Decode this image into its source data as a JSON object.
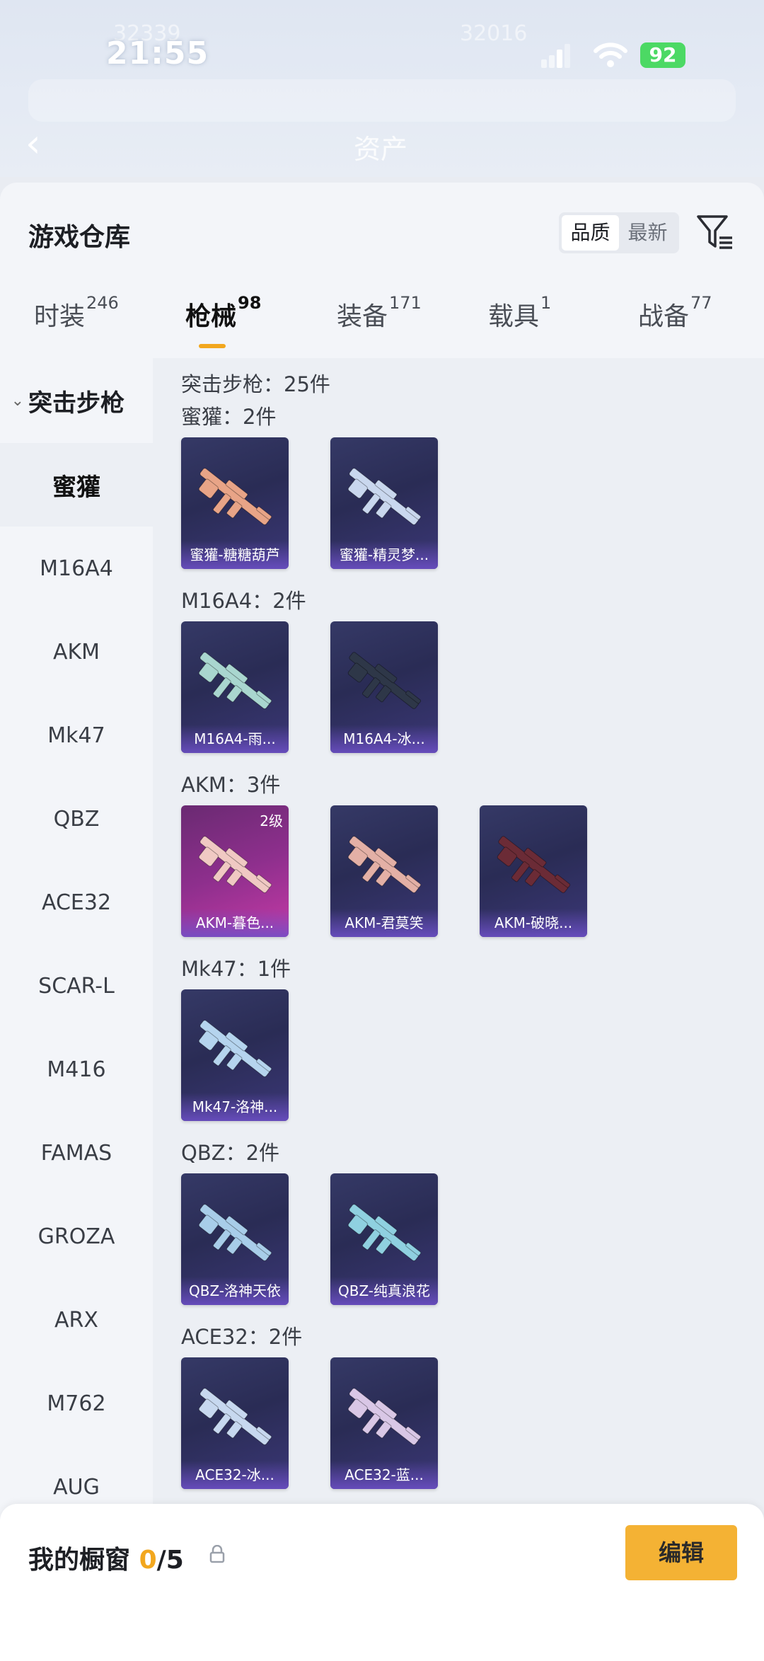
{
  "status_bar": {
    "time": "21:55",
    "battery": "92",
    "blurred_left": "32339",
    "blurred_right": "32016"
  },
  "nav": {
    "title": "资产"
  },
  "sheet": {
    "title": "游戏仓库",
    "sort": {
      "quality": "品质",
      "newest": "最新",
      "active": "quality"
    },
    "tabs": [
      {
        "label": "时装",
        "count": "246"
      },
      {
        "label": "枪械",
        "count": "98"
      },
      {
        "label": "装备",
        "count": "171"
      },
      {
        "label": "载具",
        "count": "1"
      },
      {
        "label": "战备",
        "count": "77"
      }
    ],
    "active_tab": "枪械",
    "accent_color": "#f2a71e"
  },
  "sidebar": {
    "category": "突击步枪",
    "items": [
      "蜜獾",
      "M16A4",
      "AKM",
      "Mk47",
      "QBZ",
      "ACE32",
      "SCAR-L",
      "M416",
      "FAMAS",
      "GROZA",
      "ARX",
      "M762",
      "AUG"
    ],
    "active": "蜜獾"
  },
  "content": {
    "total": "突击步枪：25件",
    "groups": [
      {
        "title": "蜜獾：2件",
        "items": [
          {
            "name": "蜜獾-糖糖葫芦",
            "color": "#e8a487",
            "badge": ""
          },
          {
            "name": "蜜獾-精灵梦...",
            "color": "#c9d7ee",
            "badge": ""
          }
        ]
      },
      {
        "title": "M16A4：2件",
        "items": [
          {
            "name": "M16A4-雨...",
            "color": "#a9d6cf",
            "badge": ""
          },
          {
            "name": "M16A4-冰...",
            "color": "#2e3748",
            "badge": ""
          }
        ]
      },
      {
        "title": "AKM：3件",
        "items": [
          {
            "name": "AKM-暮色...",
            "color": "#f0c9c3",
            "badge": "2级",
            "tier": "purple"
          },
          {
            "name": "AKM-君莫笑",
            "color": "#e3b0a6",
            "badge": ""
          },
          {
            "name": "AKM-破晓...",
            "color": "#6b2b36",
            "badge": ""
          }
        ]
      },
      {
        "title": "Mk47：1件",
        "items": [
          {
            "name": "Mk47-洛神...",
            "color": "#b5d4ee",
            "badge": ""
          }
        ]
      },
      {
        "title": "QBZ：2件",
        "items": [
          {
            "name": "QBZ-洛神天依",
            "color": "#a8cde9",
            "badge": ""
          },
          {
            "name": "QBZ-纯真浪花",
            "color": "#8fd0e0",
            "badge": ""
          }
        ]
      },
      {
        "title": "ACE32：2件",
        "items": [
          {
            "name": "ACE32-冰...",
            "color": "#c7d8ef",
            "badge": ""
          },
          {
            "name": "ACE32-蓝...",
            "color": "#d9c7e6",
            "badge": ""
          }
        ]
      }
    ]
  },
  "showcase": {
    "title": "我的橱窗",
    "count": "0",
    "total": "/5",
    "edit_label": "编辑"
  }
}
